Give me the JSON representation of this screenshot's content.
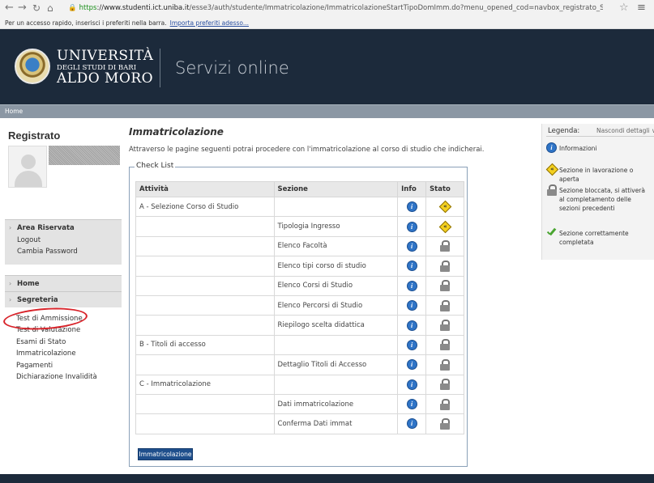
{
  "browser": {
    "url_https": "https",
    "url_host": "://www.studenti.ict.uniba.it",
    "url_path": "/esse3/auth/studente/Immatricolazione/ImmatricolazioneStartTipoDomImm.do?menu_opened_cod=navbox_registrato_Segreteria",
    "bookmarks_text": "Per un accesso rapido, inserisci i preferiti nella barra.",
    "bookmarks_link": "Importa preferiti adesso..."
  },
  "header": {
    "university_line1": "UNIVERSITÀ",
    "university_line2": "DEGLI STUDI DI BARI",
    "university_line3": "ALDO MORO",
    "service_title": "Servizi online"
  },
  "homebar": {
    "label": "Home"
  },
  "sidebar": {
    "title": "Registrato",
    "area_title": "Area Riservata",
    "area_links": [
      "Logout",
      "Cambia Password"
    ],
    "home_label": "Home",
    "segreteria_label": "Segreteria",
    "segreteria_links": [
      "Test di Ammissione",
      "Test di Valutazione",
      "Esami di Stato",
      "Immatricolazione",
      "Pagamenti",
      "Dichiarazione Invalidità"
    ]
  },
  "main": {
    "title": "Immatricolazione",
    "description": "Attraverso le pagine seguenti potrai procedere con l'immatricolazione al corso di studio che indicherai.",
    "checklist_legend": "Check List",
    "columns": [
      "Attività",
      "Sezione",
      "Info",
      "Stato"
    ],
    "rows": [
      {
        "attivita": "A - Selezione Corso di Studio",
        "sezione": "",
        "stato": "in-progress"
      },
      {
        "attivita": "",
        "sezione": "Tipologia Ingresso",
        "stato": "in-progress"
      },
      {
        "attivita": "",
        "sezione": "Elenco Facoltà",
        "stato": "locked"
      },
      {
        "attivita": "",
        "sezione": "Elenco tipi corso di studio",
        "stato": "locked"
      },
      {
        "attivita": "",
        "sezione": "Elenco Corsi di Studio",
        "stato": "locked"
      },
      {
        "attivita": "",
        "sezione": "Elenco Percorsi di Studio",
        "stato": "locked"
      },
      {
        "attivita": "",
        "sezione": "Riepilogo scelta didattica",
        "stato": "locked"
      },
      {
        "attivita": "B - Titoli di accesso",
        "sezione": "",
        "stato": "locked"
      },
      {
        "attivita": "",
        "sezione": "Dettaglio Titoli di Accesso",
        "stato": "locked"
      },
      {
        "attivita": "C - Immatricolazione",
        "sezione": "",
        "stato": "locked"
      },
      {
        "attivita": "",
        "sezione": "Dati immatricolazione",
        "stato": "locked"
      },
      {
        "attivita": "",
        "sezione": "Conferma Dati immat",
        "stato": "locked"
      }
    ],
    "button_label": "Immatricolazione"
  },
  "legend": {
    "title": "Legenda:",
    "hide_label": "Nascondi dettagli",
    "items": [
      {
        "icon": "info-icon",
        "text": "Informazioni"
      },
      {
        "icon": "in-progress-icon",
        "text": "Sezione in lavorazione o aperta"
      },
      {
        "icon": "lock-icon",
        "text": "Sezione bloccata, si attiverà al completamento delle sezioni precedenti"
      },
      {
        "icon": "check-icon",
        "text": "Sezione correttamente completata"
      }
    ]
  },
  "colors": {
    "header_bg": "#1c2a3b",
    "homebar_bg": "#8b97a4",
    "button_bg": "#1f4f8c",
    "annotation_red": "#d8232a",
    "info_blue": "#2f74c7",
    "warn_yellow": "#f4d01f"
  }
}
